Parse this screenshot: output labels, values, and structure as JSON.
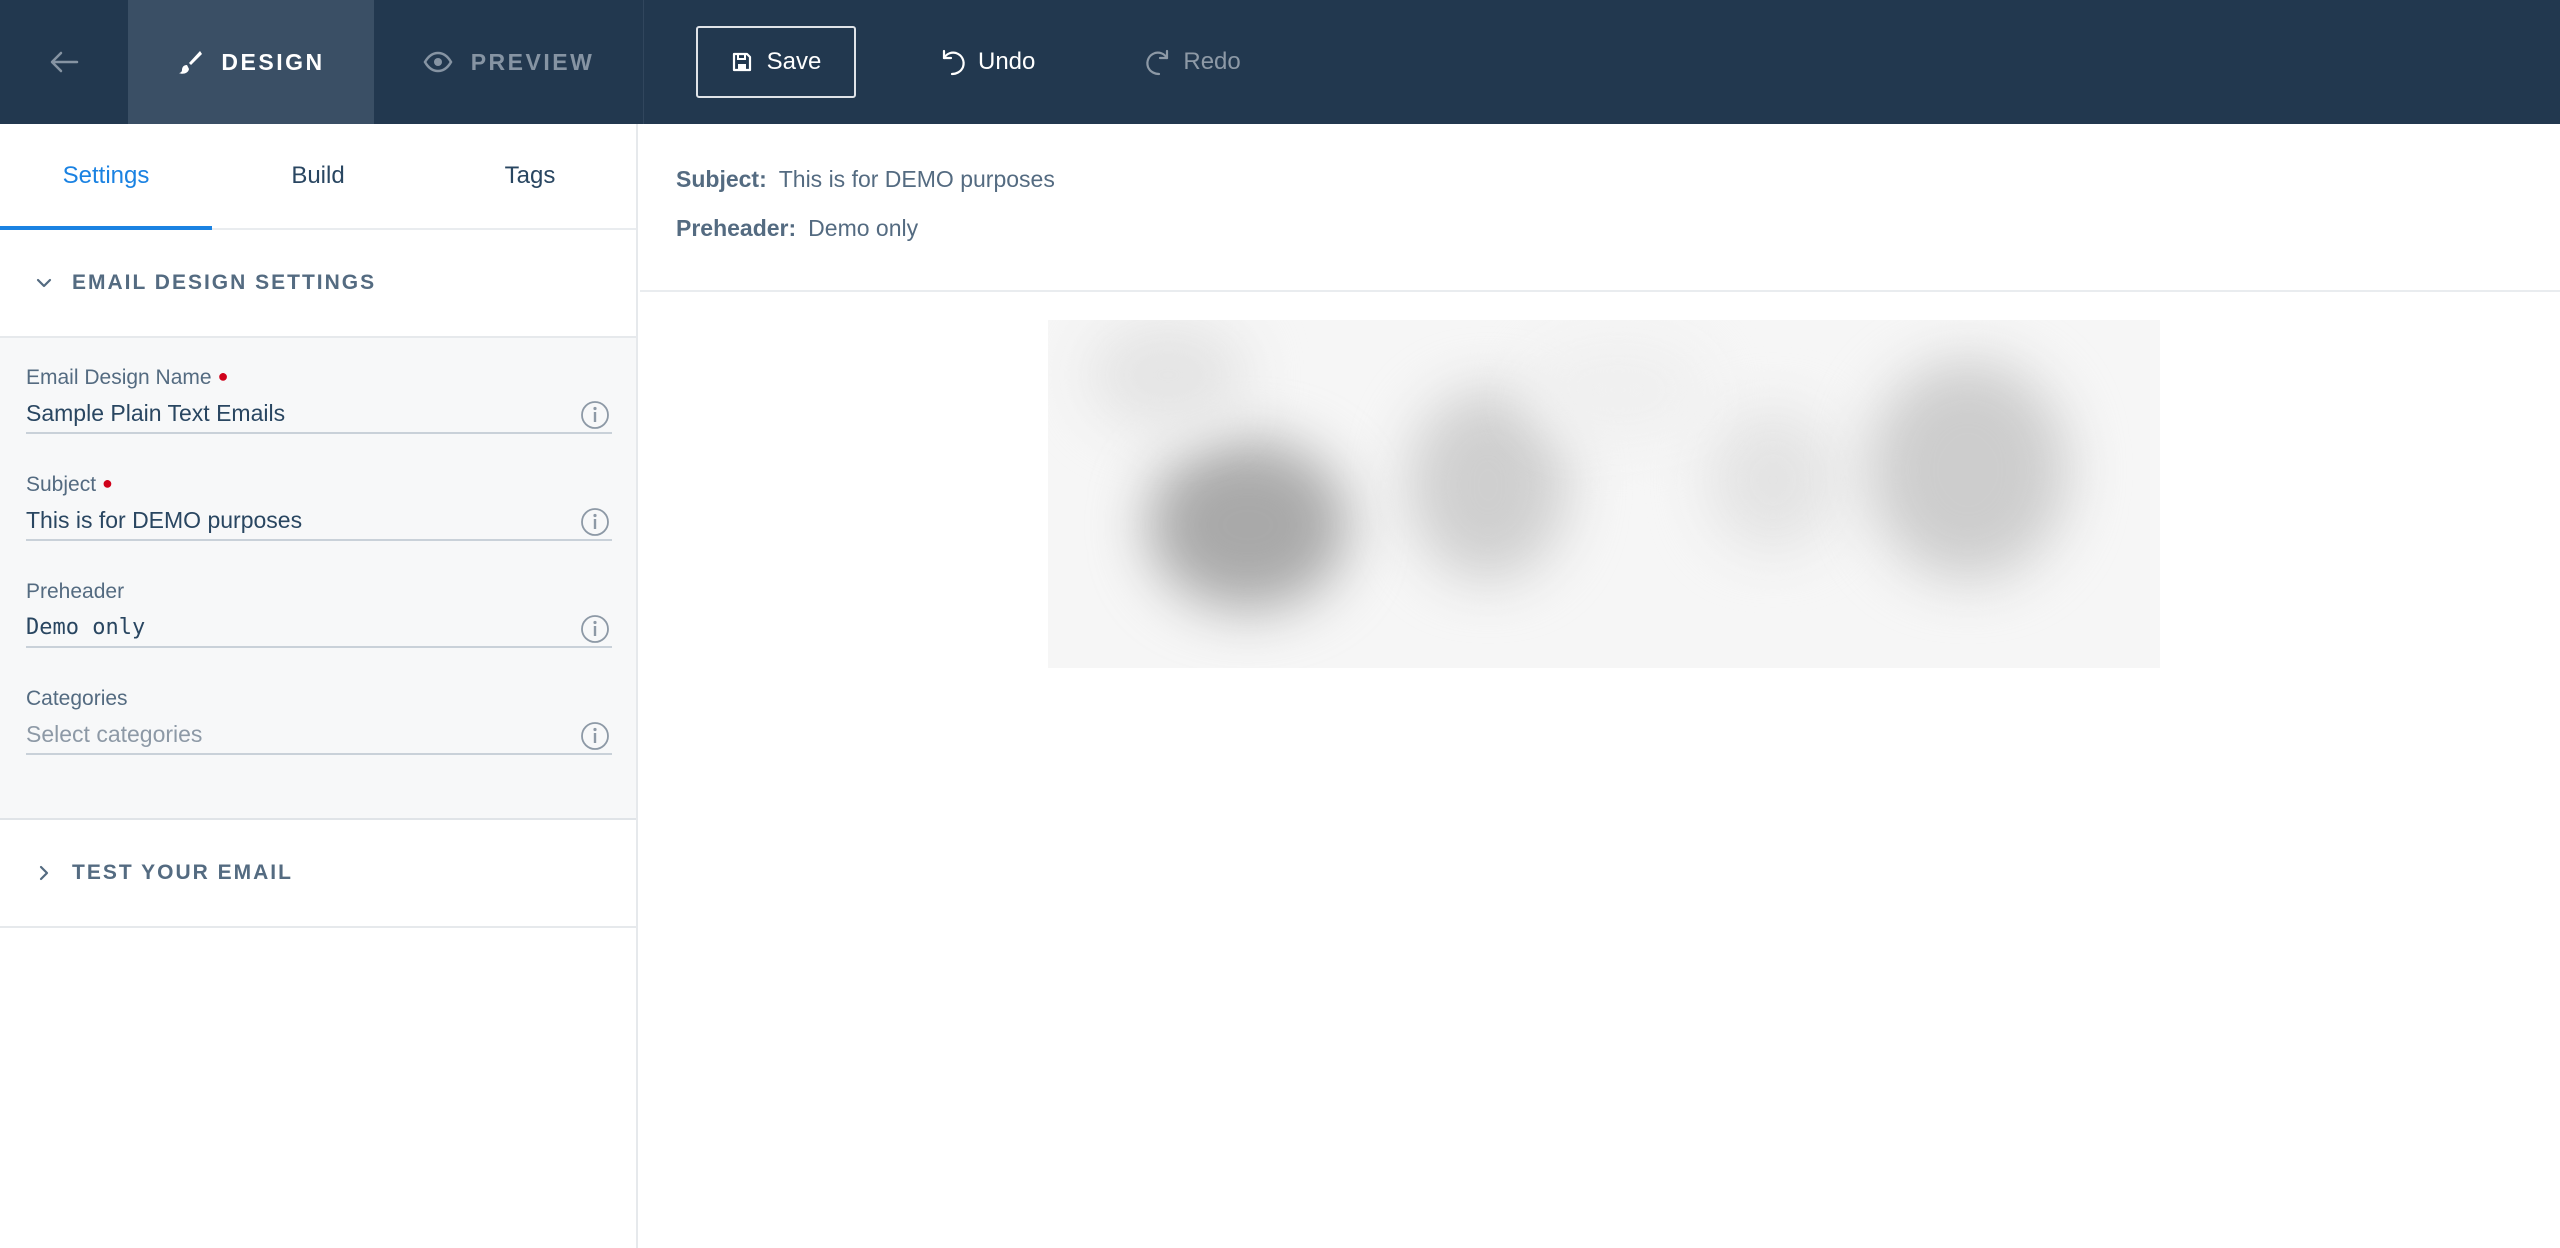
{
  "topbar": {
    "modes": [
      {
        "label": "DESIGN",
        "active": true
      },
      {
        "label": "PREVIEW",
        "active": false
      }
    ],
    "save_label": "Save",
    "undo_label": "Undo",
    "redo_label": "Redo"
  },
  "sidebar": {
    "tabs": [
      {
        "label": "Settings",
        "active": true
      },
      {
        "label": "Build",
        "active": false
      },
      {
        "label": "Tags",
        "active": false
      }
    ],
    "section_settings": "EMAIL DESIGN SETTINGS",
    "fields": {
      "name": {
        "label": "Email Design Name",
        "value": "Sample Plain Text Emails"
      },
      "subject": {
        "label": "Subject",
        "value": "This is for DEMO purposes"
      },
      "preheader": {
        "label": "Preheader",
        "value": "Demo only"
      },
      "categories": {
        "label": "Categories",
        "placeholder": "Select categories"
      }
    },
    "section_test": "TEST YOUR EMAIL"
  },
  "main": {
    "subject_key": "Subject:",
    "subject_value": "This is for DEMO purposes",
    "preheader_key": "Preheader:",
    "preheader_value": "Demo only"
  },
  "colors": {
    "topbar_bg": "#22384f",
    "accent": "#1a82e2",
    "required": "#d0021b"
  },
  "icons": {
    "back": "arrow-left-icon",
    "design": "paintbrush-icon",
    "preview": "eye-icon",
    "save": "floppy-disk-icon",
    "undo": "undo-icon",
    "redo": "redo-icon",
    "info": "info-icon",
    "expand": "chevron-down-icon",
    "collapse": "chevron-right-icon"
  }
}
